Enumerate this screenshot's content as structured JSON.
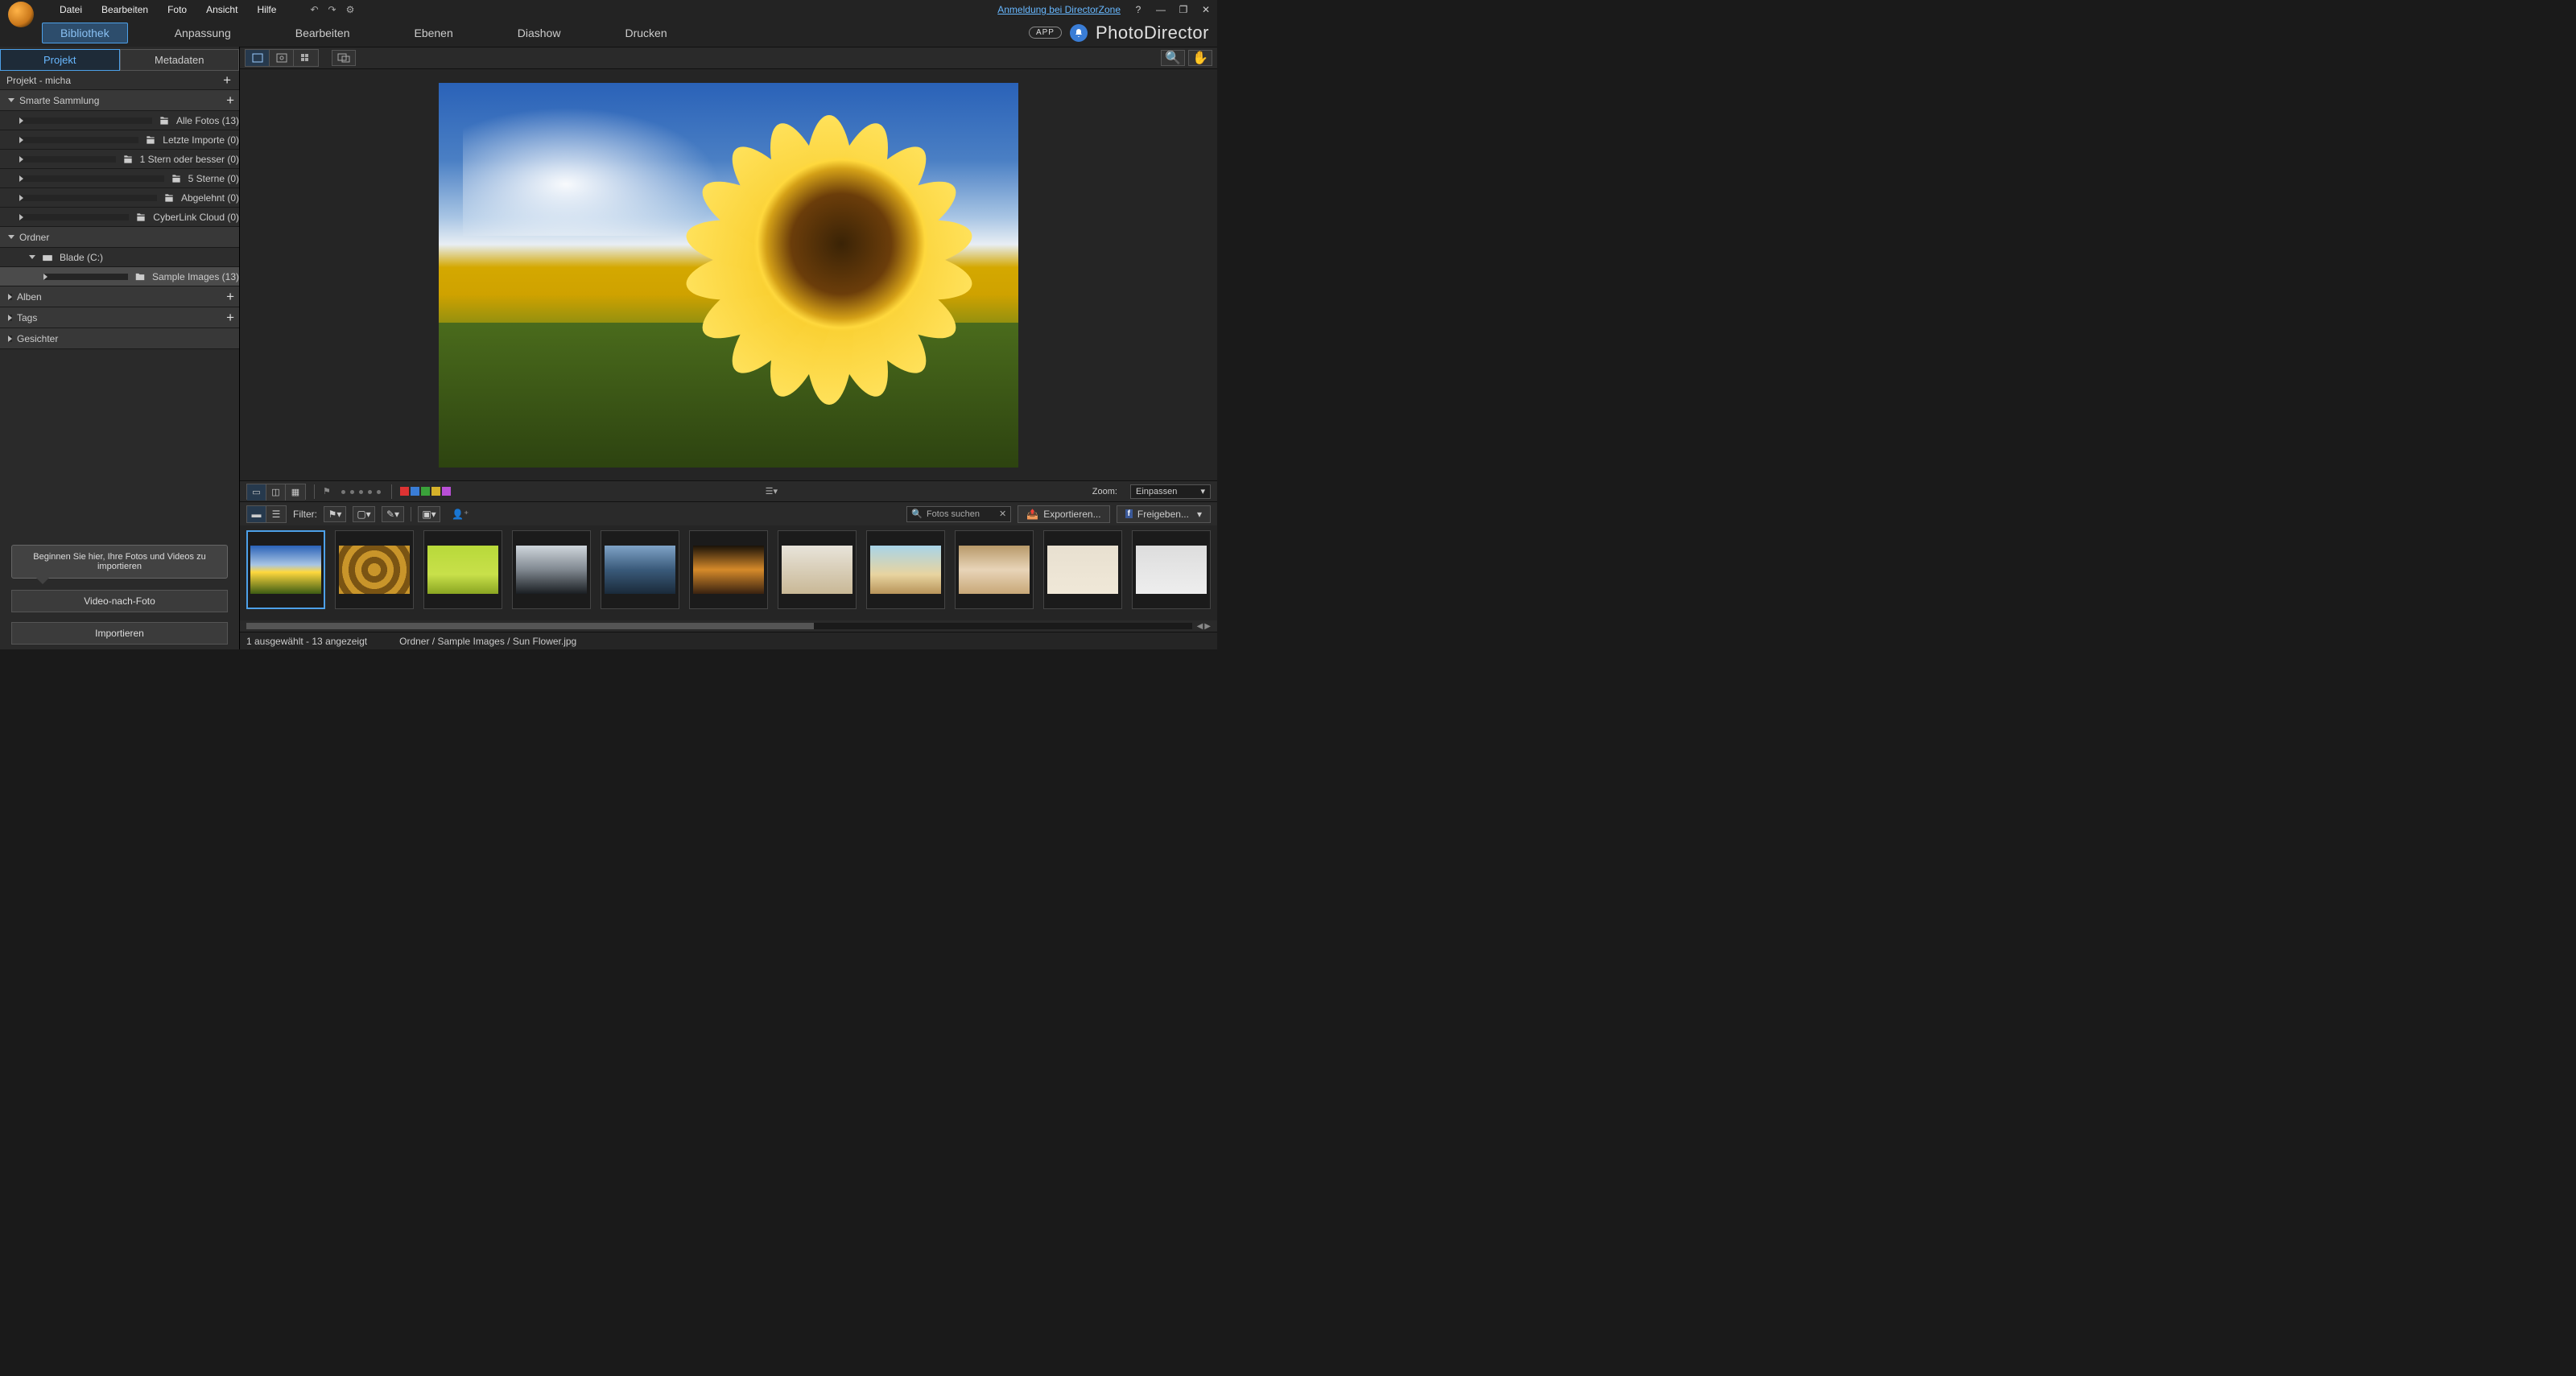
{
  "menubar": {
    "items": [
      "Datei",
      "Bearbeiten",
      "Foto",
      "Ansicht",
      "Hilfe"
    ],
    "dz_link": "Anmeldung bei DirectorZone"
  },
  "modules": {
    "tabs": [
      "Bibliothek",
      "Anpassung",
      "Bearbeiten",
      "Ebenen",
      "Diashow",
      "Drucken"
    ],
    "active": 0,
    "app_badge": "APP",
    "app_title": "PhotoDirector"
  },
  "left": {
    "tabs": [
      "Projekt",
      "Metadaten"
    ],
    "active": 0,
    "project_row": "Projekt - micha",
    "smart_label": "Smarte Sammlung",
    "smart_items": [
      "Alle Fotos (13)",
      "Letzte Importe (0)",
      "1 Stern oder besser (0)",
      "5 Sterne (0)",
      "Abgelehnt (0)",
      "CyberLink Cloud (0)"
    ],
    "folder_label": "Ordner",
    "drive": "Blade (C:)",
    "drive_child": "Sample Images (13)",
    "albums_label": "Alben",
    "tags_label": "Tags",
    "faces_label": "Gesichter",
    "tooltip": "Beginnen Sie hier, Ihre Fotos und Videos zu importieren",
    "btn_video": "Video-nach-Foto",
    "btn_import": "Importieren"
  },
  "filterbar": {
    "filter_label": "Filter:",
    "search_placeholder": "Fotos suchen",
    "export": "Exportieren...",
    "share": "Freigeben...",
    "zoom_label": "Zoom:",
    "zoom_value": "Einpassen",
    "colors": [
      "#d33",
      "#3a7dd6",
      "#3aa23a",
      "#d6b22a",
      "#b94fd6"
    ]
  },
  "thumbs": [
    {
      "bg": "linear-gradient(to bottom,#2a62b8 0%,#a8c5e4 40%,#ffd83d 55%,#3d5c14 100%)"
    },
    {
      "bg": "repeating-radial-gradient(circle,#c9952a 0 8px,#7a5413 8px 16px)"
    },
    {
      "bg": "linear-gradient(to bottom,#b8d93a 0%,#c8e04a 60%,#8aa522 100%)"
    },
    {
      "bg": "linear-gradient(to bottom,#cfd6dc 0%,#808890 50%,#1a1e22 100%)"
    },
    {
      "bg": "linear-gradient(to bottom,#7fa3c7 0%,#3a5a7a 50%,#1a2a3a 100%)"
    },
    {
      "bg": "linear-gradient(to bottom,#1a1208 0%,#d68a2a 50%,#3a2210 100%)"
    },
    {
      "bg": "linear-gradient(to bottom,#e8e4da 0%,#c9b896 100%)"
    },
    {
      "bg": "linear-gradient(to bottom,#a8d4e8 0%,#e8d4a0 60%,#b8945a 100%)"
    },
    {
      "bg": "linear-gradient(to bottom,#b89a6a 0%,#e8d4b8 50%,#c8a878 100%)"
    },
    {
      "bg": "linear-gradient(to bottom,#e8e0d0 0%,#f0e8d8 100%)"
    },
    {
      "bg": "linear-gradient(to bottom,#ddd 0%,#eee 100%)"
    }
  ],
  "status": {
    "selection": "1 ausgewählt - 13 angezeigt",
    "path": "Ordner / Sample Images / Sun Flower.jpg"
  }
}
